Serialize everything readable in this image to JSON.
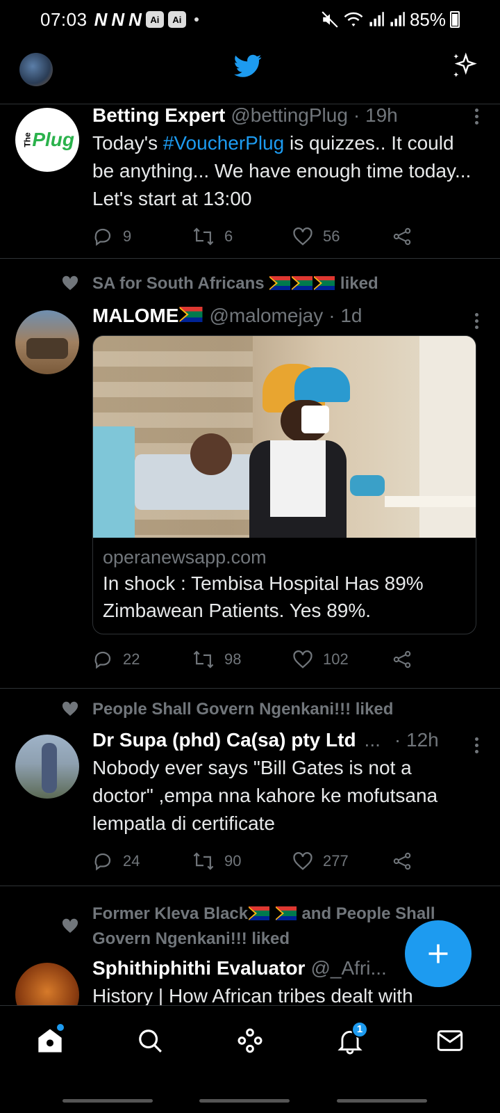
{
  "status": {
    "time": "07:03",
    "notif_icons": [
      "N",
      "N",
      "N"
    ],
    "ai_badge": "Ai",
    "battery": "85%"
  },
  "tweets": [
    {
      "name": "Betting Expert",
      "handle": "@bettingPlug",
      "time": "· 19h",
      "text_a": "Today's ",
      "hashtag": "#VoucherPlug",
      "text_b": " is quizzes.. It could be anything... We have enough time today... Let's start at 13:00",
      "avatar_text": "Plug",
      "avatar_prefix": "The",
      "replies": "9",
      "retweets": "6",
      "likes": "56"
    },
    {
      "liked_by": "SA for South Africans",
      "liked_suffix": "liked",
      "name": "MALOME",
      "handle": "@malomejay",
      "time": "· 1d",
      "card_domain": "operanewsapp.com",
      "card_title": "In shock : Tembisa Hospital Has 89% Zimbawean Patients. Yes 89%.",
      "replies": "22",
      "retweets": "98",
      "likes": "102"
    },
    {
      "liked_by": "People Shall Govern Ngenkani!!! liked",
      "name": "Dr Supa (phd) Ca(sa) pty Ltd",
      "ellipsis": "...",
      "time": "· 12h",
      "text": "Nobody ever says \"Bill Gates is not a doctor\" ,empa nna kahore ke mofutsana lempatla di certificate",
      "replies": "24",
      "retweets": "90",
      "likes": "277"
    },
    {
      "liked_by_a": "Former Kleva Black",
      "liked_by_b": "and People Shall Govern Ngenkani!!! liked",
      "name": "Sphithiphithi Evaluator",
      "handle": "@_Afri...",
      "text": "History | How African tribes dealt with"
    }
  ],
  "nav": {
    "notifications_badge": "1"
  },
  "colors": {
    "accent": "#1d9bf0",
    "background": "#000000",
    "muted": "#71767b"
  }
}
